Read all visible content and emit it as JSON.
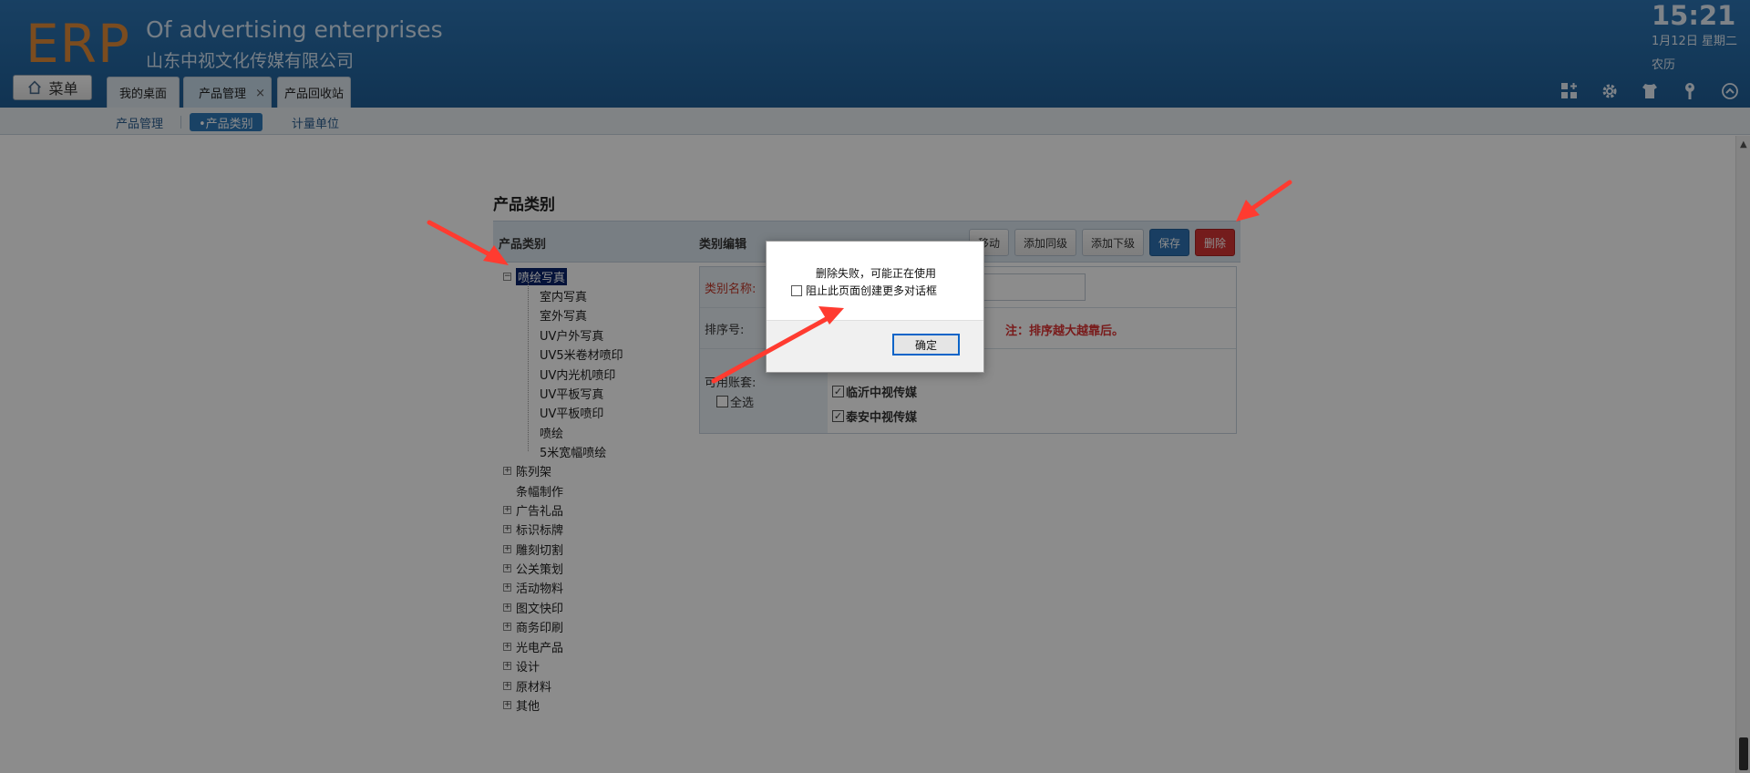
{
  "header": {
    "logo": "ERP",
    "company_en": "Of advertising enterprises",
    "company_cn": "山东中视文化传媒有限公司",
    "time": "15:21",
    "date": "1月12日 星期二",
    "lunar": "农历",
    "menu_label": "菜单",
    "tabs": [
      {
        "label": "我的桌面"
      },
      {
        "label": "产品管理",
        "close": "×"
      },
      {
        "label": "产品回收站"
      }
    ],
    "icons": [
      "grid-plus-icon",
      "gear-icon",
      "shirt-icon",
      "key-icon",
      "collapse-up-icon"
    ]
  },
  "subnav": {
    "items": [
      "产品管理",
      "•产品类别",
      "计量单位"
    ]
  },
  "page": {
    "title": "产品类别",
    "tree_header": "产品类别",
    "edit_header": "类别编辑",
    "buttons": {
      "move": "移动",
      "add_sibling": "添加同级",
      "add_child": "添加下级",
      "save": "保存",
      "delete": "删除"
    }
  },
  "tree": {
    "root_selected": "喷绘写真",
    "children": [
      "室内写真",
      "室外写真",
      "UV户外写真",
      "UV5米卷材喷印",
      "UV内光机喷印",
      "UV平板写真",
      "UV平板喷印",
      "喷绘",
      "5米宽幅喷绘"
    ],
    "others": [
      {
        "label": "陈列架",
        "expander": "+"
      },
      {
        "label": "条幅制作",
        "expander": ""
      },
      {
        "label": "广告礼品",
        "expander": "+"
      },
      {
        "label": "标识标牌",
        "expander": "+"
      },
      {
        "label": "雕刻切割",
        "expander": "+"
      },
      {
        "label": "公关策划",
        "expander": "+"
      },
      {
        "label": "活动物料",
        "expander": "+"
      },
      {
        "label": "图文快印",
        "expander": "+"
      },
      {
        "label": "商务印刷",
        "expander": "+"
      },
      {
        "label": "光电产品",
        "expander": "+"
      },
      {
        "label": "设计",
        "expander": "+"
      },
      {
        "label": "原材料",
        "expander": "+"
      },
      {
        "label": "其他",
        "expander": "+"
      }
    ]
  },
  "form": {
    "name_label": "类别名称:",
    "sort_label": "排序号:",
    "sort_hint": "注：排序越大越靠后。",
    "accounts_label": "可用账套:",
    "select_all": "全选",
    "accounts": [
      "临沂中视传媒",
      "泰安中视传媒"
    ]
  },
  "dialog": {
    "message": "删除失败，可能正在使用",
    "checkbox_label": "阻止此页面创建更多对话框",
    "ok_label": "确定"
  }
}
